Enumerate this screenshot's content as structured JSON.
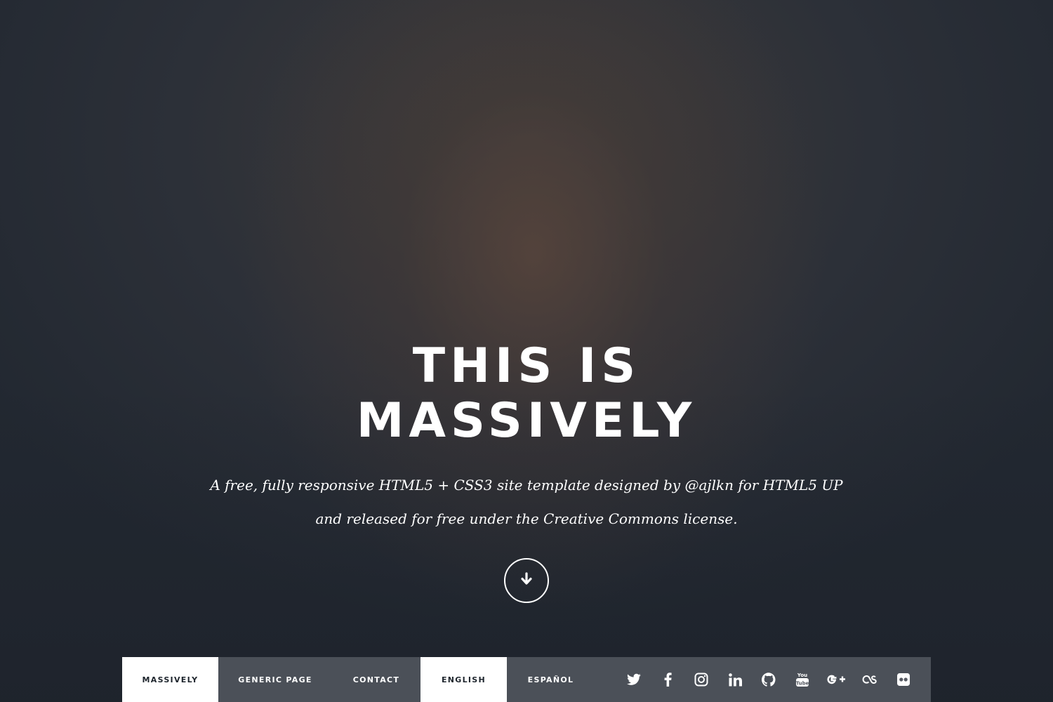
{
  "hero": {
    "title_line1": "THIS IS",
    "title_line2": "MASSIVELY",
    "tagline_line1": "A free, fully responsive HTML5 + CSS3 site template designed by @ajlkn for HTML5 UP",
    "tagline_line2": "and released for free under the Creative Commons license.",
    "scroll_icon": "arrow-down-icon"
  },
  "nav": {
    "items": [
      {
        "label": "MASSIVELY",
        "active": true
      },
      {
        "label": "GENERIC PAGE",
        "active": false
      },
      {
        "label": "CONTACT",
        "active": false
      },
      {
        "label": "ENGLISH",
        "active": true
      },
      {
        "label": "ESPAÑOL",
        "active": false
      }
    ],
    "social_icons": [
      "twitter-icon",
      "facebook-icon",
      "instagram-icon",
      "linkedin-icon",
      "github-icon",
      "youtube-icon",
      "google-plus-icon",
      "lastfm-icon",
      "flickr-icon"
    ]
  },
  "colors": {
    "background": "#222730",
    "nav_background": "#565a62",
    "active_tab": "#ffffff",
    "text": "#ffffff"
  }
}
